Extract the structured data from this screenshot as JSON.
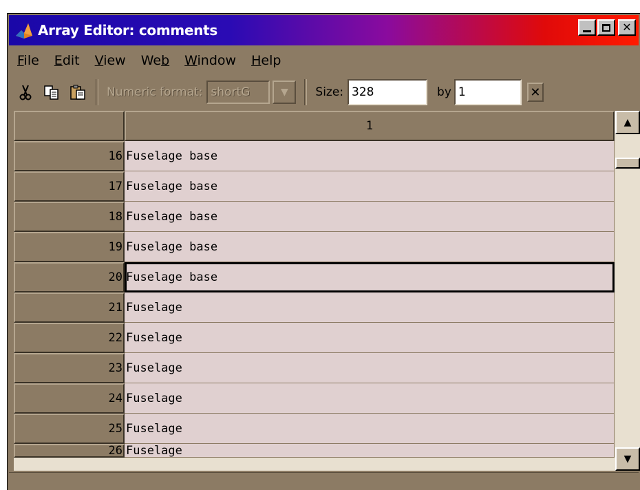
{
  "window": {
    "title": "Array Editor: comments",
    "icon": "matlab-logo-icon",
    "controls": [
      "minimize-icon",
      "maximize-icon",
      "close-icon"
    ]
  },
  "menu": [
    {
      "label": "File",
      "mnemonic": "F"
    },
    {
      "label": "Edit",
      "mnemonic": "E"
    },
    {
      "label": "View",
      "mnemonic": "V"
    },
    {
      "label": "Web",
      "mnemonic": "b"
    },
    {
      "label": "Window",
      "mnemonic": "W"
    },
    {
      "label": "Help",
      "mnemonic": "H"
    }
  ],
  "toolbar": {
    "icons": [
      "cut-icon",
      "copy-icon",
      "paste-icon"
    ],
    "numeric_format_label": "Numeric format:",
    "numeric_format_value": "shortG",
    "size_label": "Size:",
    "size_rows": "328",
    "by_label": "by",
    "size_cols": "1"
  },
  "grid": {
    "column_header": "1",
    "rows": [
      {
        "index": "16",
        "value": "Fuselage base"
      },
      {
        "index": "17",
        "value": "Fuselage base"
      },
      {
        "index": "18",
        "value": "Fuselage base"
      },
      {
        "index": "19",
        "value": "Fuselage base"
      },
      {
        "index": "20",
        "value": "Fuselage base",
        "selected": true
      },
      {
        "index": "21",
        "value": "Fuselage"
      },
      {
        "index": "22",
        "value": "Fuselage"
      },
      {
        "index": "23",
        "value": "Fuselage"
      },
      {
        "index": "24",
        "value": "Fuselage"
      },
      {
        "index": "25",
        "value": "Fuselage"
      },
      {
        "index": "26",
        "value": "Fuselage",
        "partial": true
      }
    ]
  },
  "colors": {
    "title_gradient_start": "#1a07a8",
    "title_gradient_end": "#ff1a00",
    "chrome": "#8c7b64",
    "cell_background": "#e0d0d0"
  }
}
